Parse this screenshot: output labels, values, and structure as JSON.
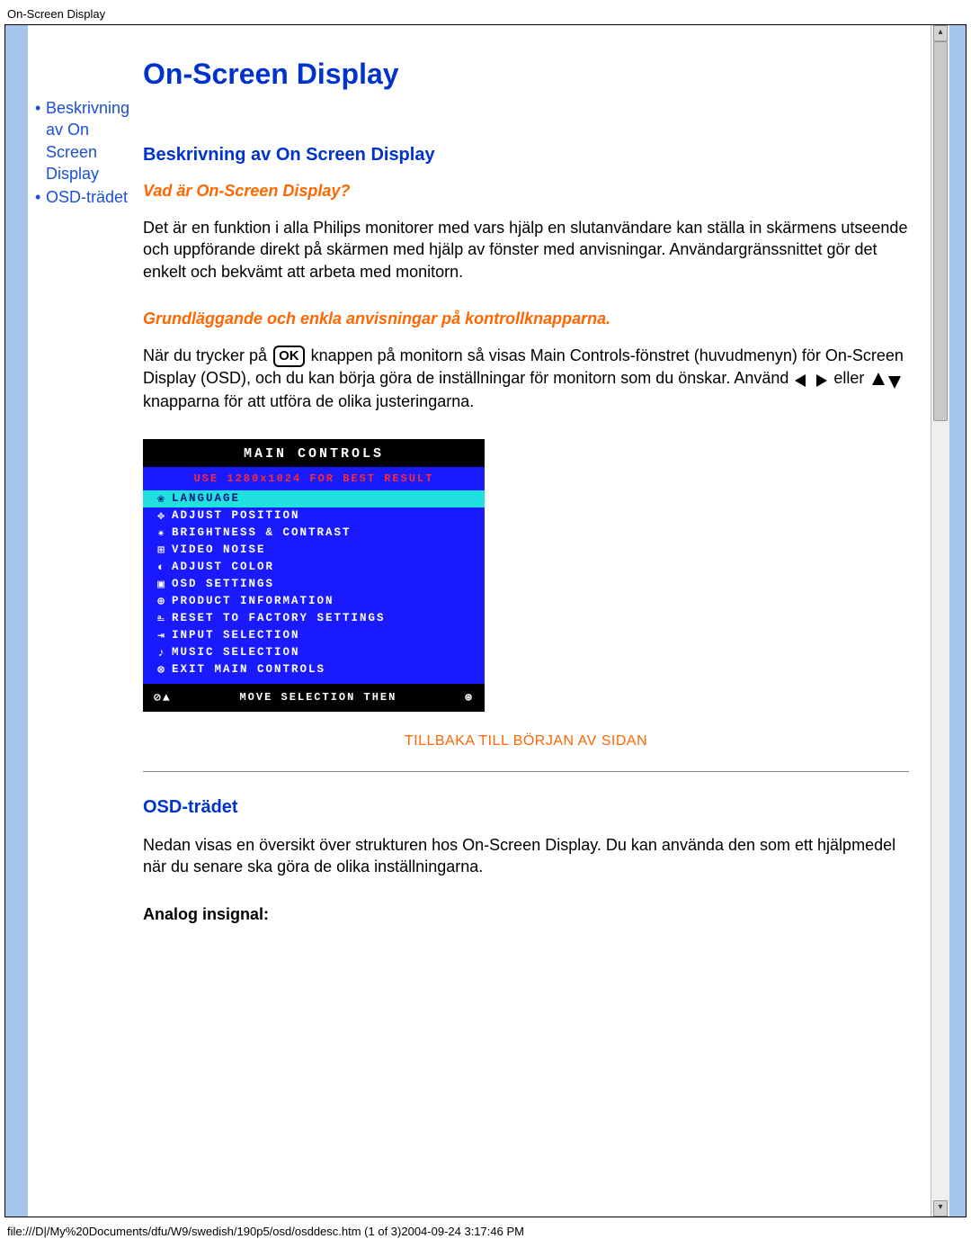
{
  "header_title": "On-Screen Display",
  "footer_text": "file:///D|/My%20Documents/dfu/W9/swedish/190p5/osd/osddesc.htm (1 of 3)2004-09-24 3:17:46 PM",
  "sidebar": {
    "items": [
      {
        "bullet": "•",
        "label": "Beskrivning av On Screen Display"
      },
      {
        "bullet": "•",
        "label": "OSD-trädet"
      }
    ]
  },
  "page": {
    "title": "On-Screen Display",
    "section1_heading": "Beskrivning av On Screen Display",
    "sub1": "Vad är On-Screen Display?",
    "para1": "Det är en funktion i alla Philips monitorer med vars hjälp en slutanvändare kan ställa in skärmens utseende och uppförande direkt på skärmen med hjälp av fönster med anvisningar. Användargränssnittet gör det enkelt och bekvämt att arbeta med monitorn.",
    "sub2": "Grundläggande och enkla anvisningar på kontrollknapparna.",
    "para2a": "När du trycker på ",
    "ok_label": "OK",
    "para2b": " knappen på monitorn så visas Main Controls-fönstret (huvudmenyn) för On-Screen Display (OSD), och du kan börja göra de inställningar för monitorn som du önskar. Använd ",
    "para2c": " eller ",
    "para2d": " knapparna för att utföra de olika justeringarna.",
    "back_to_top": "TILLBAKA TILL BÖRJAN AV SIDAN",
    "section2_heading": "OSD-trädet",
    "para3": "Nedan visas en översikt över strukturen hos On-Screen Display. Du kan använda den som ett hjälpmedel när du senare ska göra de olika inställningarna.",
    "analog_heading": "Analog insignal:"
  },
  "osd": {
    "title": "MAIN CONTROLS",
    "warn": "USE 1280x1024 FOR BEST RESULT",
    "items": [
      {
        "icon": "globe-icon",
        "glyph": "❀",
        "label": "LANGUAGE",
        "highlight": true
      },
      {
        "icon": "position-icon",
        "glyph": "✥",
        "label": "ADJUST POSITION",
        "highlight": false
      },
      {
        "icon": "brightness-icon",
        "glyph": "✷",
        "label": "BRIGHTNESS & CONTRAST",
        "highlight": false
      },
      {
        "icon": "noise-icon",
        "glyph": "⊞",
        "label": "VIDEO NOISE",
        "highlight": false
      },
      {
        "icon": "color-icon",
        "glyph": "◐",
        "label": "ADJUST COLOR",
        "highlight": false
      },
      {
        "icon": "osd-settings-icon",
        "glyph": "▣",
        "label": "OSD SETTINGS",
        "highlight": false
      },
      {
        "icon": "info-icon",
        "glyph": "⊕",
        "label": "PRODUCT INFORMATION",
        "highlight": false
      },
      {
        "icon": "factory-icon",
        "glyph": "⎁",
        "label": "RESET TO FACTORY SETTINGS",
        "highlight": false
      },
      {
        "icon": "input-icon",
        "glyph": "⇥",
        "label": "INPUT SELECTION",
        "highlight": false
      },
      {
        "icon": "music-icon",
        "glyph": "♪",
        "label": "MUSIC SELECTION",
        "highlight": false
      },
      {
        "icon": "exit-icon",
        "glyph": "⊗",
        "label": "EXIT MAIN CONTROLS",
        "highlight": false
      }
    ],
    "footer_left_glyphs": "⊘▲",
    "footer_text": "MOVE SELECTION THEN",
    "footer_right_glyphs": "⊛"
  }
}
